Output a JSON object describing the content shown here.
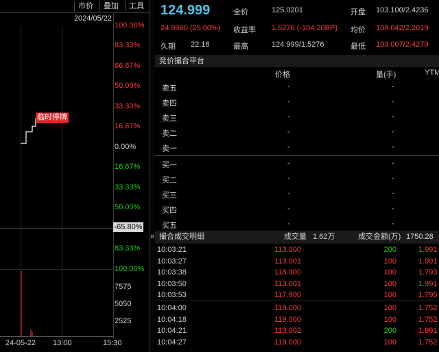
{
  "toolbar": {
    "btn1": "市价",
    "btn2": "叠加",
    "btn3": "工具"
  },
  "chart": {
    "date": "2024/05/22",
    "pct_labels": [
      {
        "text": "100.00%",
        "dir": "up"
      },
      {
        "text": "83.33%",
        "dir": "up"
      },
      {
        "text": "66.67%",
        "dir": "up"
      },
      {
        "text": "50.00%",
        "dir": "up"
      },
      {
        "text": "33.33%",
        "dir": "up"
      },
      {
        "text": "16.67%",
        "dir": "up"
      },
      {
        "text": "0.00%",
        "dir": "flat"
      },
      {
        "text": "16.67%",
        "dir": "down"
      },
      {
        "text": "33.33%",
        "dir": "down"
      },
      {
        "text": "50.00%",
        "dir": "down"
      },
      {
        "text": "83.33%",
        "dir": "down"
      },
      {
        "text": "100.00%",
        "dir": "down"
      }
    ],
    "current_tag": "-65.80%",
    "halt_label": "临时停牌",
    "vol_labels": [
      "7575",
      "5050",
      "2525"
    ],
    "x_labels": [
      "24-05-22",
      "13:00",
      "15:30"
    ]
  },
  "quote": {
    "price": "124.999",
    "change": "24.9990 (25.00%)",
    "full_price_label": "全价",
    "full_price": "125.0201",
    "yield_label": "收益率",
    "yield": "1.5276 (-104.20BP)",
    "open_label": "开盘",
    "open": "103.100/2.4236",
    "avg_label": "均价",
    "avg": "108.042/2.2019",
    "duration_label": "久期",
    "duration": "22.18",
    "high_label": "最高",
    "high": "124.999/1.5276",
    "low_label": "最低",
    "low": "103.007/2.4279"
  },
  "auction": {
    "title": "竞价撮合平台",
    "col_price": "价格",
    "col_qty": "量(手)",
    "col_ytm": "YTM",
    "rows": [
      {
        "name": "卖五",
        "price": "-",
        "qty": "-"
      },
      {
        "name": "卖四",
        "price": "-",
        "qty": "-"
      },
      {
        "name": "卖三",
        "price": "-",
        "qty": "-"
      },
      {
        "name": "卖二",
        "price": "-",
        "qty": "-"
      },
      {
        "name": "卖一",
        "price": "-",
        "qty": "-"
      },
      {
        "name": "买一",
        "price": "-",
        "qty": "-"
      },
      {
        "name": "买二",
        "price": "-",
        "qty": "-"
      },
      {
        "name": "买三",
        "price": "-",
        "qty": "-"
      },
      {
        "name": "买四",
        "price": "-",
        "qty": "-"
      },
      {
        "name": "买五",
        "price": "-",
        "qty": "-"
      }
    ]
  },
  "trades": {
    "collapse": "»",
    "title": "撮合成交明细",
    "vol_label": "成交量",
    "vol": "1.62万",
    "amt_label": "成交金额(万)",
    "amt": "1750.28",
    "rows": [
      {
        "time": "10:03:21",
        "price": "113.000",
        "arrow": "↓",
        "vol": "200",
        "amt": "1.991"
      },
      {
        "time": "10:03:27",
        "price": "113.001",
        "arrow": "↑",
        "vol": "100",
        "amt": "1.991"
      },
      {
        "time": "10:03:38",
        "price": "118.000",
        "arrow": "↑",
        "vol": "100",
        "amt": "1.793"
      },
      {
        "time": "10:03:50",
        "price": "113.001",
        "arrow": "↓",
        "vol": "100",
        "amt": "1.991"
      },
      {
        "time": "10:03:53",
        "price": "117.900",
        "arrow": "↑",
        "vol": "100",
        "amt": "1.795"
      },
      {
        "time": "10:04:00",
        "price": "119.000",
        "arrow": "↑",
        "vol": "100",
        "amt": "1.752"
      },
      {
        "time": "10:04:18",
        "price": "119.000",
        "arrow": "",
        "vol": "100",
        "amt": "1.752"
      },
      {
        "time": "10:04:21",
        "price": "113.002",
        "arrow": "↓",
        "vol": "200",
        "amt": "1.991"
      },
      {
        "time": "10:04:27",
        "price": "119.000",
        "arrow": "↑",
        "vol": "100",
        "amt": "1.752"
      }
    ]
  },
  "colors": {
    "up": "#ff3b3b",
    "down": "#1bd21b",
    "price": "#4ec4e8"
  }
}
